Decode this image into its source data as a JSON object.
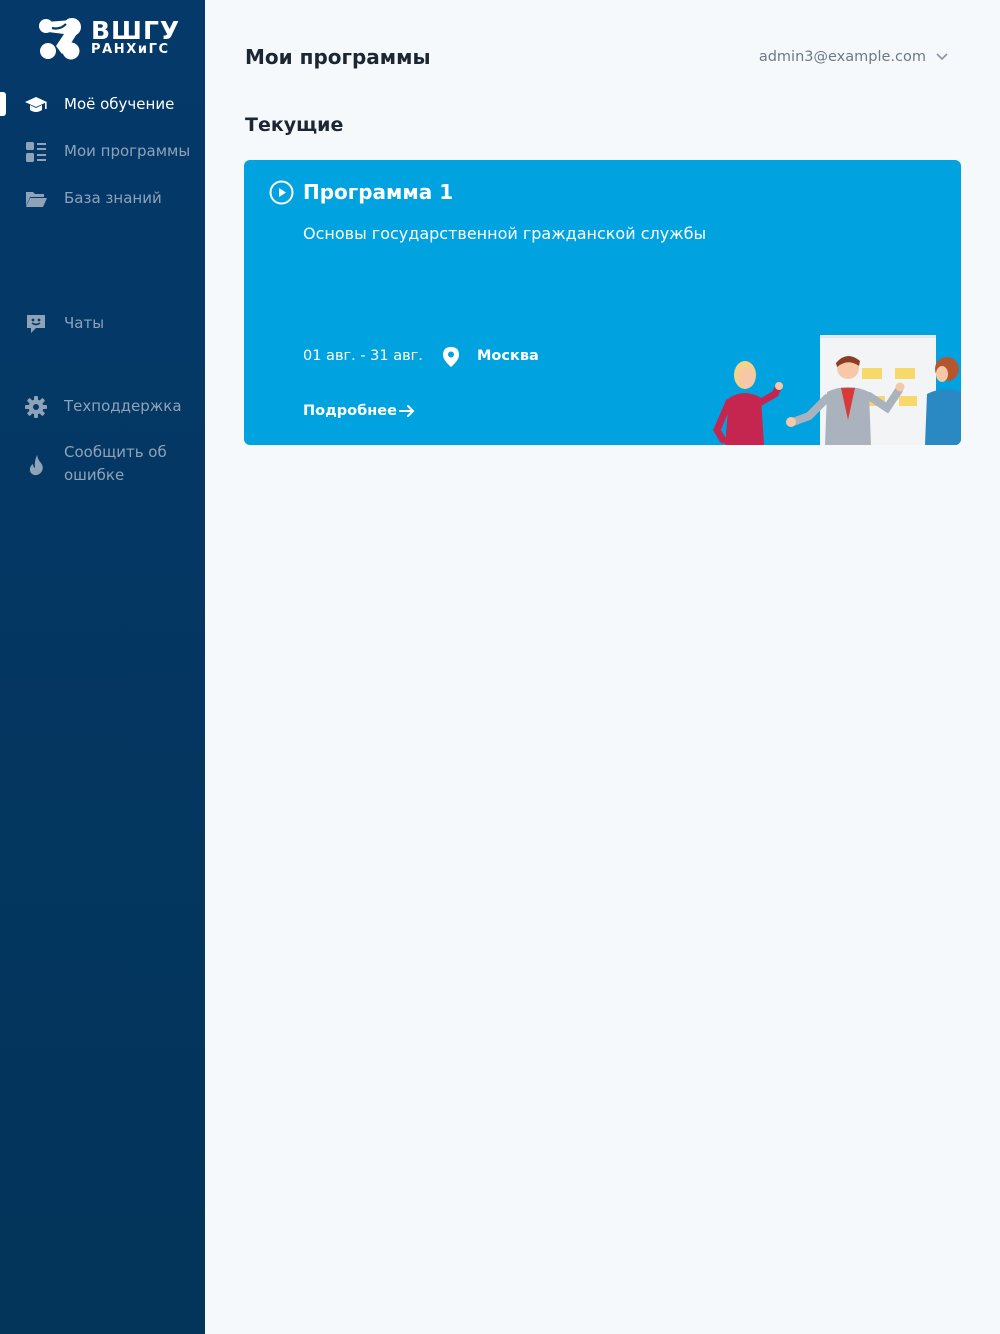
{
  "logo": {
    "line1": "ВШГУ",
    "line2": "РАНХиГС"
  },
  "sidebar": {
    "items": [
      {
        "label": "Моё обучение",
        "icon": "graduation-cap-icon",
        "active": true
      },
      {
        "label": "Мои программы",
        "icon": "list-icon",
        "active": false
      },
      {
        "label": "База знаний",
        "icon": "folder-open-icon",
        "active": false
      },
      {
        "label": "Чаты",
        "icon": "chat-icon",
        "active": false
      },
      {
        "label": "Техподдержка",
        "icon": "gear-icon",
        "active": false
      },
      {
        "label": "Сообщить об ошибке",
        "icon": "flame-icon",
        "active": false
      }
    ]
  },
  "header": {
    "title": "Мои программы",
    "user_email": "admin3@example.com"
  },
  "main": {
    "section_title": "Текущие",
    "programs": [
      {
        "title": "Программа 1",
        "subtitle": "Основы государственной гражданской службы",
        "dates": "01 авг. - 31 авг.",
        "city": "Москва",
        "more_label": "Подробнее"
      }
    ]
  },
  "colors": {
    "sidebar_bg": "#04396a",
    "card_bg": "#00a3e0",
    "page_bg": "#f5f9fc",
    "text_dark": "#1d2733",
    "nav_inactive": "#8fa3b8"
  }
}
